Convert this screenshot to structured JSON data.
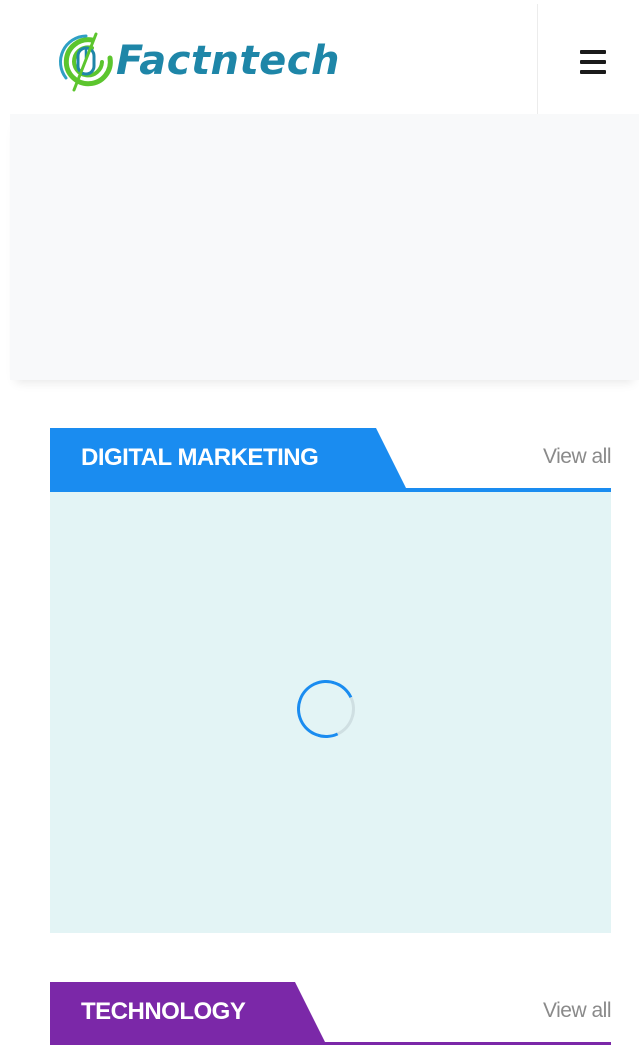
{
  "header": {
    "logo_text": "Factntech",
    "logo_icon": "mouse-target-icon",
    "menu_icon": "hamburger-menu-icon"
  },
  "sections": [
    {
      "title": "DIGITAL MARKETING",
      "view_all": "View all",
      "color": "#1a8cf0",
      "loading": true
    },
    {
      "title": "TECHNOLOGY",
      "view_all": "View all",
      "color": "#7b28a8"
    }
  ],
  "colors": {
    "brand": "#1e86a8",
    "brand_green": "#5cc52e",
    "panel_bg": "#e3f4f5",
    "ad_bg": "#f8f9fa"
  }
}
